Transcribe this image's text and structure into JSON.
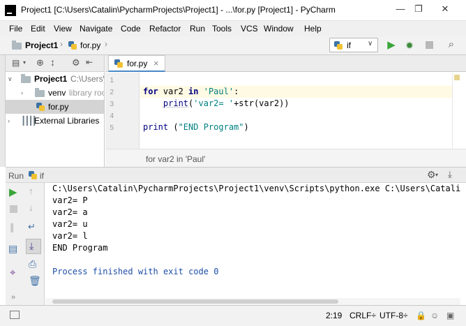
{
  "window": {
    "title": "Project1 [C:\\Users\\Catalin\\PycharmProjects\\Project1] - ...\\for.py [Project1] - PyCharm",
    "minimize_glyph": "—",
    "restore_glyph": "❐",
    "close_glyph": "✕"
  },
  "menu": [
    "File",
    "Edit",
    "View",
    "Navigate",
    "Code",
    "Refactor",
    "Run",
    "Tools",
    "VCS",
    "Window",
    "Help"
  ],
  "navbar": {
    "project": "Project1",
    "file": "for.py",
    "run_config": "if"
  },
  "project_tree": {
    "root_name": "Project1",
    "root_path": "C:\\Users\\",
    "venv_name": "venv",
    "venv_note": "library roo",
    "file": "for.py",
    "external": "External Libraries"
  },
  "editor": {
    "tab_label": "for.py",
    "tab_close": "×",
    "line_numbers": [
      "1",
      "2",
      "3",
      "4",
      "5"
    ],
    "breadcrumb": "for var2 in 'Paul'"
  },
  "run_panel": {
    "label": "Run",
    "config": "if",
    "output": [
      "C:\\Users\\Catalin\\PycharmProjects\\Project1\\venv\\Scripts\\python.exe C:\\Users\\Catalin\\Py",
      "var2= P",
      "var2= a",
      "var2= u",
      "var2= l",
      "END Program",
      "",
      "Process finished with exit code 0"
    ]
  },
  "status": {
    "position": "2:19",
    "line_sep": "CRLF÷",
    "encoding": "UTF-8÷"
  },
  "colors": {
    "keyword": "#000080",
    "string": "#008080",
    "process_finished": "#1f4fa8",
    "run_green": "#3aa53a"
  }
}
